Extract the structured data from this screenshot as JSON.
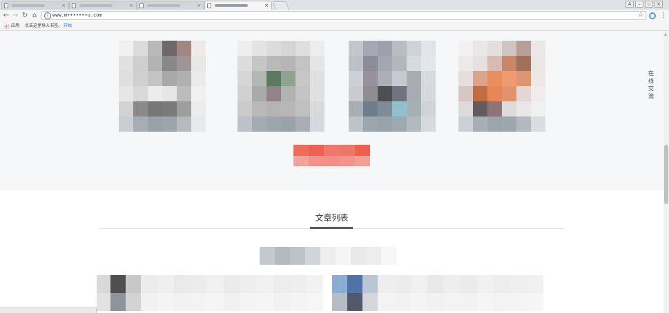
{
  "browser": {
    "tabs": [
      {
        "title": ""
      },
      {
        "title": ""
      },
      {
        "title": ""
      },
      {
        "title": ""
      }
    ],
    "url": "www.m•••••••u.com",
    "bookmarks": {
      "apps_label": "应用",
      "import_label": "点击这里导入书签。",
      "start_label": "开始"
    },
    "status_text": ""
  },
  "page": {
    "float_chat_label": "在线交流",
    "cta_label": "",
    "section_title": "文章列表"
  },
  "colors": {
    "hero_bg": "#f6f7f9",
    "accent_red": "#f06a5c",
    "title_underline": "#555b60",
    "scrollbar_thumb": "#c1c1c1"
  }
}
